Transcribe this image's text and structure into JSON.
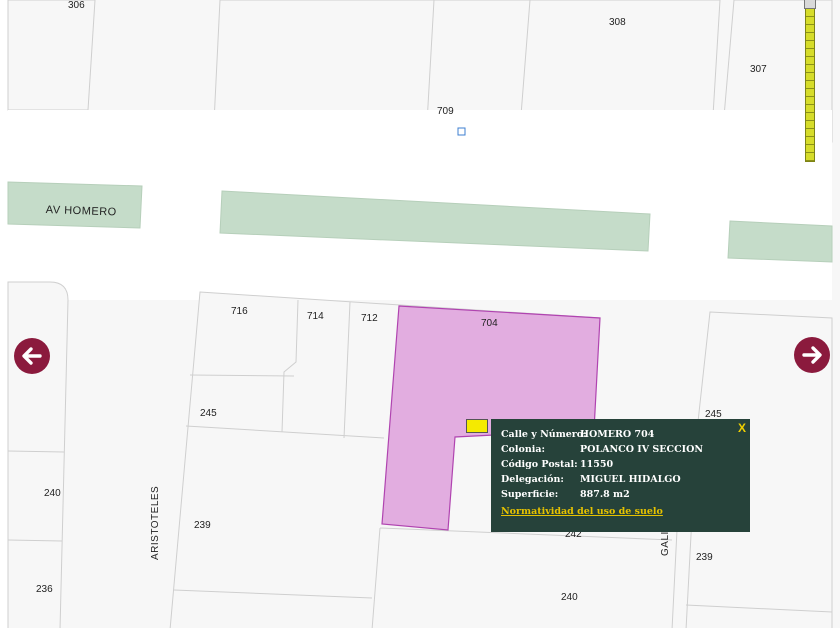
{
  "map": {
    "street_labels": {
      "av_homero": "AV HOMERO",
      "aristoteles": "ARISTOTELES",
      "galileo": "GALILEO"
    },
    "lot_numbers": {
      "n306": "306",
      "n308": "308",
      "n307": "307",
      "n709": "709",
      "n716": "716",
      "n714": "714",
      "n712": "712",
      "n704": "704",
      "n245_left": "245",
      "n245_right": "245",
      "n240_left": "240",
      "n239_left": "239",
      "n236": "236",
      "n242": "242",
      "n240_bottom": "240",
      "n239_right": "239"
    },
    "colors": {
      "street_blocks": "#f7f7f7",
      "road": "#ffffff",
      "median": "#c5dcc9",
      "selected_lot_fill": "#e2ade0",
      "selected_lot_stroke": "#b044b0",
      "nav_button": "#8b1a3d",
      "popup_bg": "#26423a"
    }
  },
  "navigation": {
    "left_icon": "arrow-left-icon",
    "right_icon": "arrow-right-icon"
  },
  "info_popup": {
    "close_label": "X",
    "rows": [
      {
        "label": "Calle y Número:",
        "value": "HOMERO 704"
      },
      {
        "label": "Colonia:",
        "value": "POLANCO IV SECCION"
      },
      {
        "label": "Código Postal:",
        "value": "11550"
      },
      {
        "label": "Delegación:",
        "value": "MIGUEL HIDALGO"
      },
      {
        "label": "Superficie:",
        "value": "887.8 m2"
      }
    ],
    "link_label": "Normatividad del uso de suelo"
  }
}
